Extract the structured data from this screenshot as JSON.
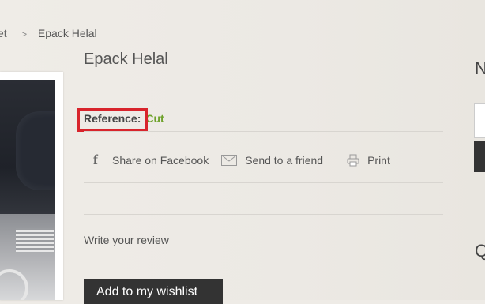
{
  "breadcrumb": {
    "partial_prev": "et",
    "separator": ">",
    "current": "Epack Helal"
  },
  "product": {
    "title": "Epack Helal",
    "reference_label": "Reference:",
    "reference_value": "Cut"
  },
  "actions": {
    "facebook": "Share on Facebook",
    "send_friend": "Send to a friend",
    "print": "Print"
  },
  "review": {
    "write_label": "Write your review"
  },
  "wishlist": {
    "button_label": "Add to my wishlist"
  },
  "right_column": {
    "heading_partial": "N",
    "heading2_partial": "Q"
  },
  "colors": {
    "reference_value": "#6fa22c",
    "highlight": "#d8242c",
    "button_bg": "#333333"
  },
  "icons": [
    "facebook-icon",
    "mail-icon",
    "print-icon"
  ]
}
